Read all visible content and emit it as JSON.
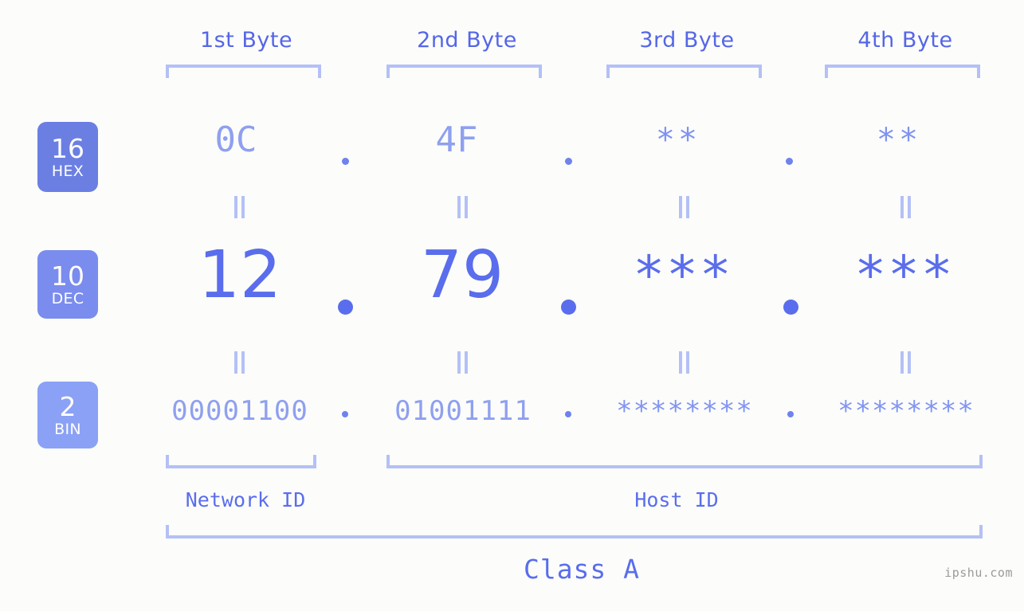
{
  "meta": {
    "watermark": "ipshu.com"
  },
  "columns": [
    {
      "header": "1st Byte"
    },
    {
      "header": "2nd Byte"
    },
    {
      "header": "3rd Byte"
    },
    {
      "header": "4th Byte"
    }
  ],
  "bases": [
    {
      "num": "16",
      "abbr": "HEX"
    },
    {
      "num": "10",
      "abbr": "DEC"
    },
    {
      "num": "2",
      "abbr": "BIN"
    }
  ],
  "rows": {
    "hex": {
      "values": [
        "0C",
        "4F",
        "**",
        "**"
      ],
      "known": [
        true,
        true,
        false,
        false
      ]
    },
    "dec": {
      "values": [
        "12",
        "79",
        "***",
        "***"
      ],
      "known": [
        true,
        true,
        false,
        false
      ]
    },
    "bin": {
      "values": [
        "00001100",
        "01001111",
        "********",
        "********"
      ],
      "known": [
        true,
        true,
        false,
        false
      ]
    }
  },
  "separators": {
    "glyph": ".",
    "equals_glyph": "||"
  },
  "footer": {
    "network_id": "Network ID",
    "host_id": "Host ID",
    "class_label": "Class A"
  },
  "colors": {
    "background": "#fcfdfa",
    "header_text": "#5566e8",
    "bracket": "#b4c0f7",
    "hex_value": "#8fa0f0",
    "dec_value": "#5a6ded",
    "bin_value": "#8fa0f0",
    "badge_hex": "#6b7fe3",
    "badge_dec": "#7a8cee",
    "badge_bin": "#8ba1f5",
    "watermark": "#9a9a9a"
  }
}
